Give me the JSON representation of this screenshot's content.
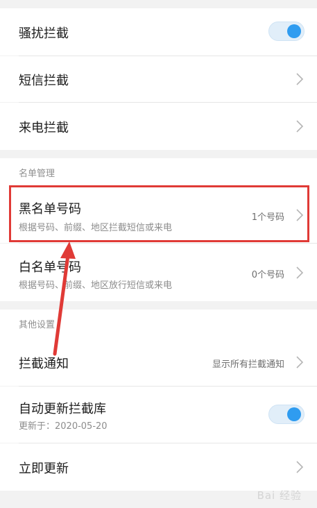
{
  "colors": {
    "accent": "#2f9cf0",
    "annotation": "#e03a36"
  },
  "rows": {
    "harass": {
      "title": "骚扰拦截",
      "toggle_on": true
    },
    "sms": {
      "title": "短信拦截"
    },
    "call": {
      "title": "来电拦截"
    }
  },
  "sections": {
    "list": {
      "header": "名单管理",
      "blacklist": {
        "title": "黑名单号码",
        "subtitle": "根据号码、前缀、地区拦截短信或来电",
        "value": "1个号码"
      },
      "whitelist": {
        "title": "白名单号码",
        "subtitle": "根据号码、前缀、地区放行短信或来电",
        "value": "0个号码"
      }
    },
    "other": {
      "header": "其他设置",
      "notify": {
        "title": "拦截通知",
        "value": "显示所有拦截通知"
      },
      "auto_update": {
        "title": "自动更新拦截库",
        "subtitle": "更新于：2020-05-20",
        "toggle_on": true
      },
      "update_now": {
        "title": "立即更新"
      }
    }
  },
  "watermark": "Bai 经验"
}
